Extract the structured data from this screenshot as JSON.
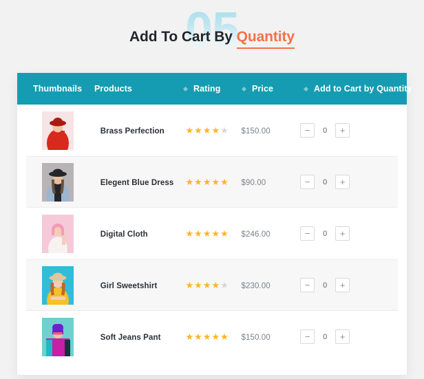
{
  "header": {
    "watermark": "05",
    "title_main": "Add To Cart By",
    "title_accent": "Quantity"
  },
  "colors": {
    "page_background": "#f2f2f2",
    "table_header": "#159cb2",
    "accent": "#f4704a",
    "star_on": "#ffb422",
    "star_off": "#d6d6d6",
    "watermark": "#a9dfec",
    "row_stripe": "#f7f7f7"
  },
  "table": {
    "columns": [
      {
        "label": "Thumbnails",
        "sortable": false
      },
      {
        "label": "Products",
        "sortable": false
      },
      {
        "label": "Rating",
        "sortable": true
      },
      {
        "label": "Price",
        "sortable": true
      },
      {
        "label": "Add to Cart by Quantity",
        "sortable": true
      }
    ],
    "stepper": {
      "decrement_label": "−",
      "increment_label": "+"
    },
    "rows": [
      {
        "name": "Brass Perfection",
        "rating": 4,
        "rating_max": 5,
        "price": "$150.00",
        "quantity": "0",
        "thumb": {
          "bg": "#f6e4e6",
          "subject": "#d62a1e",
          "accent": "#a91b14",
          "skin": "#f0c6a8"
        }
      },
      {
        "name": "Elegent Blue Dress",
        "rating": 5,
        "rating_max": 5,
        "price": "$90.00",
        "quantity": "0",
        "thumb": {
          "bg": "#b8b3b4",
          "subject": "#9db6cf",
          "accent": "#24262b",
          "skin": "#e8bf9e"
        }
      },
      {
        "name": "Digital Cloth",
        "rating": 5,
        "rating_max": 5,
        "price": "$246.00",
        "quantity": "0",
        "thumb": {
          "bg": "#f6c9d8",
          "subject": "#f7f2f0",
          "accent": "#f49bb6",
          "skin": "#f3cdb4"
        }
      },
      {
        "name": "Girl Sweetshirt",
        "rating": 4,
        "rating_max": 5,
        "price": "$230.00",
        "quantity": "0",
        "thumb": {
          "bg": "#32bcd8",
          "subject": "#f5c028",
          "accent": "#e0c79a",
          "skin": "#f5cdae"
        }
      },
      {
        "name": "Soft Jeans Pant",
        "rating": 5,
        "rating_max": 5,
        "price": "$150.00",
        "quantity": "0",
        "thumb": {
          "bg": "#6fd0cf",
          "subject": "#c71fa5",
          "accent": "#6c21c9",
          "skin": "#f0c4a5"
        }
      }
    ]
  }
}
